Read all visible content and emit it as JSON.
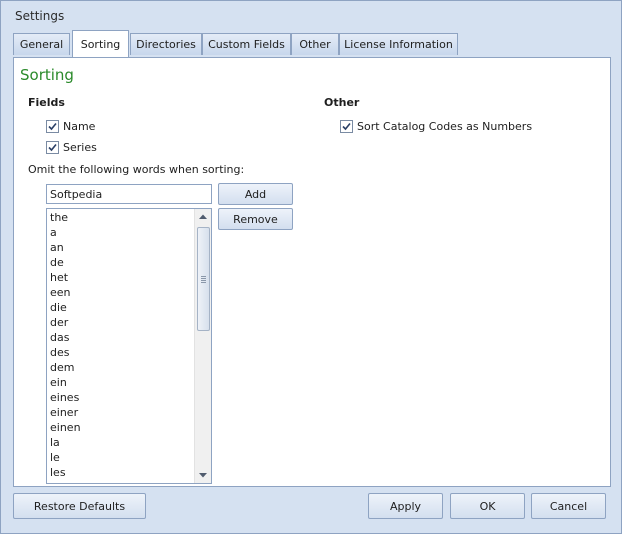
{
  "window": {
    "title": "Settings"
  },
  "tabs": [
    {
      "label": "General"
    },
    {
      "label": "Sorting"
    },
    {
      "label": "Directories"
    },
    {
      "label": "Custom Fields"
    },
    {
      "label": "Other"
    },
    {
      "label": "License Information"
    }
  ],
  "active_tab": "Sorting",
  "panel": {
    "heading": "Sorting",
    "fields": {
      "label": "Fields",
      "options": [
        {
          "label": "Name",
          "checked": true
        },
        {
          "label": "Series",
          "checked": true
        }
      ]
    },
    "other": {
      "label": "Other",
      "options": [
        {
          "label": "Sort Catalog Codes as Numbers",
          "checked": true
        }
      ]
    },
    "omit": {
      "label": "Omit the following words when sorting:",
      "input_value": "Softpedia",
      "add_label": "Add",
      "remove_label": "Remove",
      "words": [
        "the",
        "a",
        "an",
        "de",
        "het",
        "een",
        "die",
        "der",
        "das",
        "des",
        "dem",
        "ein",
        "eines",
        "einer",
        "einen",
        "la",
        "le",
        "les"
      ]
    }
  },
  "footer": {
    "restore_label": "Restore Defaults",
    "apply_label": "Apply",
    "ok_label": "OK",
    "cancel_label": "Cancel"
  },
  "colors": {
    "window_bg": "#d5e1f1",
    "border": "#8ea3c2",
    "heading_green": "#2a8a2a",
    "panel_bg": "#ffffff"
  },
  "icons": {
    "checkmark": "check-icon",
    "scroll_up": "arrow-up-icon",
    "scroll_down": "arrow-down-icon"
  }
}
